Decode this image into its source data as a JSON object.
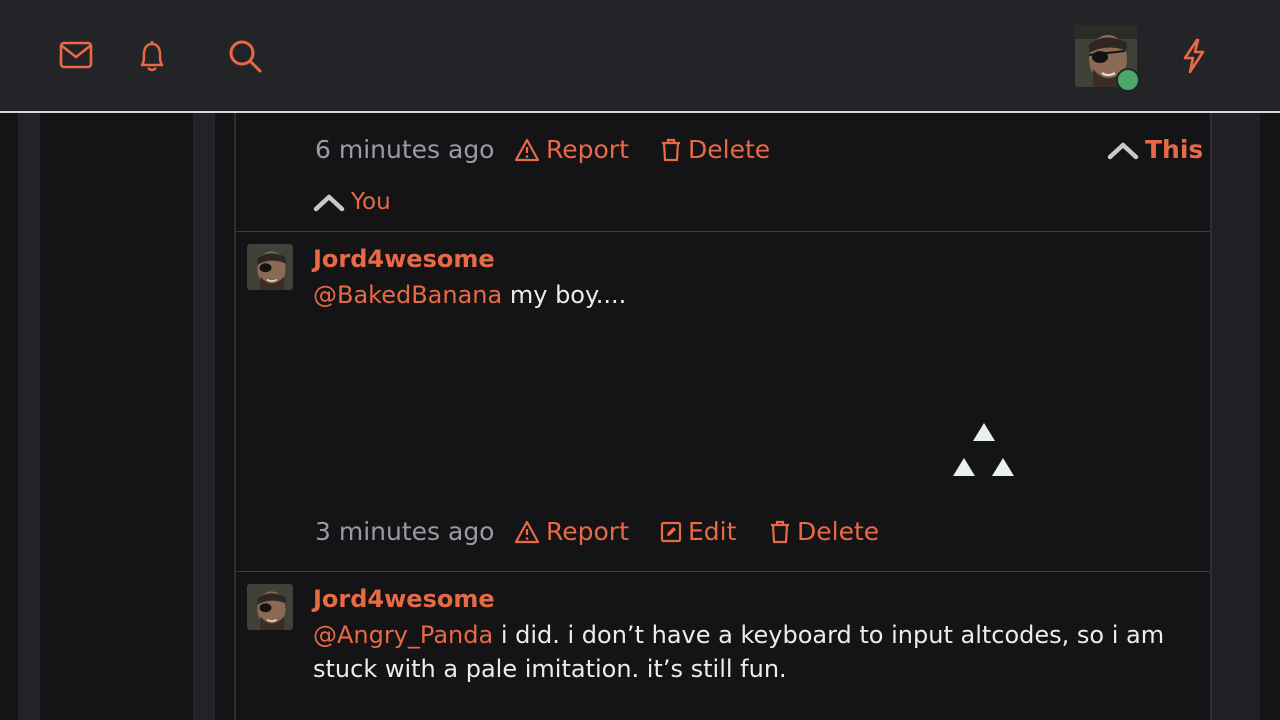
{
  "header": {
    "mail_icon": "mail-icon",
    "bell_icon": "bell-icon",
    "search_icon": "search-icon",
    "bolt_icon": "bolt-icon",
    "accent": "#e86a44",
    "status_color": "#4ea869"
  },
  "top_comment": {
    "time": "6 minutes ago",
    "report": "Report",
    "delete": "Delete",
    "vote_label": "This",
    "you_label": "You"
  },
  "comments": [
    {
      "username": "Jord4wesome",
      "mention": "@BakedBanana",
      "text": " my boy....",
      "time": "3 minutes ago",
      "report": "Report",
      "edit": "Edit",
      "delete": "Delete"
    },
    {
      "username": "Jord4wesome",
      "mention": "@Angry_Panda",
      "text": " i did. i don’t have a keyboard to input altcodes, so i am stuck with a pale imitation. it’s still fun."
    }
  ]
}
